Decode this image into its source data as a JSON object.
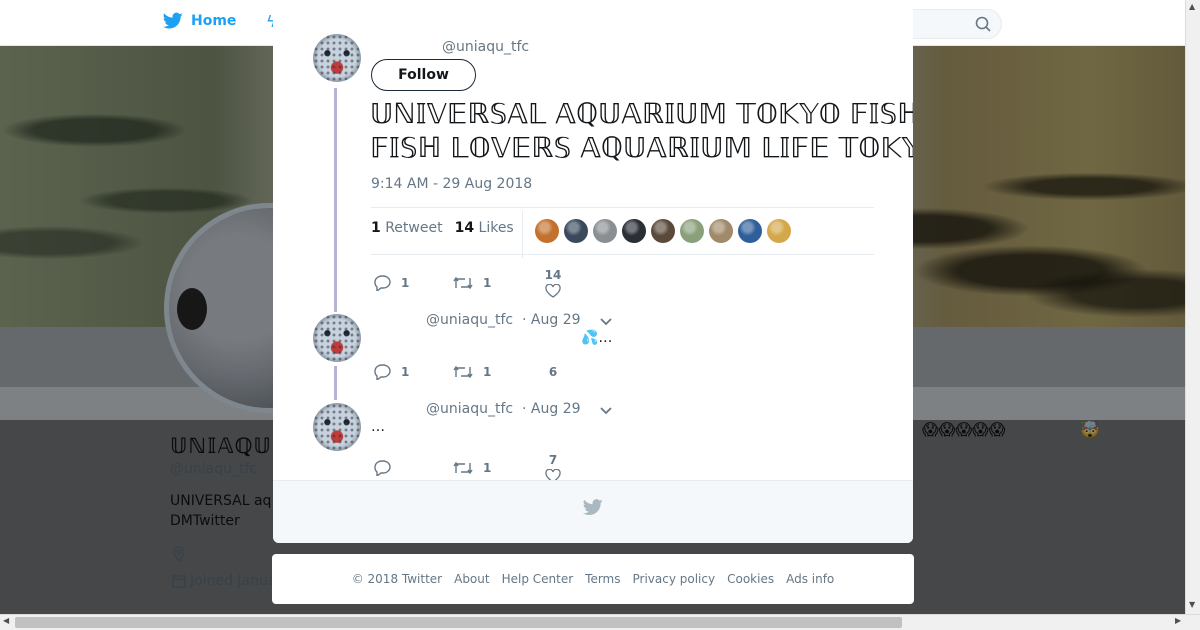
{
  "background": {
    "nav_home_label": "Home",
    "profile_name": "𝕌ℕ𝕀𝔸ℚ𝕌",
    "profile_handle": "@uniaqu_tfc",
    "bio_line1": "UNIVERSAL aq",
    "bio_line2": "DMTwitter",
    "joined": "Joined Janua",
    "emoji_right1": "😱😱😱😱😱",
    "emoji_right2": "🤯"
  },
  "tweet": {
    "handle": "@uniaqu_tfc",
    "follow_label": "Follow",
    "text_line1": "𝕌ℕ𝕀𝕍𝔼ℝ𝕊𝔸𝕃 𝔸ℚ𝕌𝔸ℝ𝕀𝕌𝕄 𝕋𝕆𝕂𝕐𝕆 𝔽𝕀𝕊ℍ ℂ𝕃𝕌𝔹 𝔸ℚ𝕌𝔸ℝ𝕀𝕌𝕄 𝕃𝕀𝔽𝔼 𝔼𝕍𝔼ℝ𝕐𝔻𝔸𝕐 𝕊𝕋𝕆ℝ𝕀𝔼𝕊",
    "text_line2": "𝔽𝕀𝕊ℍ 𝕃𝕆𝕍𝔼ℝ𝕊 𝔸ℚ𝕌𝔸ℝ𝕀𝕌𝕄 𝕃𝕀𝔽𝔼 𝕋𝕆𝕂𝕐𝕆 𝔽𝕀𝕊ℍ ℂ𝕃𝕌𝔹 𝕌ℕ𝕀𝕍𝔼ℝ𝕊𝔸𝕃 𝕋𝕆𝕂𝕐𝕆 𝔽𝕀𝕊ℍ",
    "timestamp": "9:14 AM - 29 Aug 2018",
    "retweet_count": "1",
    "retweet_label": "Retweet",
    "likes_count": "14",
    "likes_label": "Likes",
    "liker_colors": [
      "#c4712e",
      "#3a4a5c",
      "#8a8f94",
      "#2a2e35",
      "#5a4a3a",
      "#8aa07a",
      "#a08a6a",
      "#2f5f9a",
      "#d4a84a"
    ],
    "actions": {
      "reply": "1",
      "retweet": "1",
      "like": "14"
    }
  },
  "replies": [
    {
      "handle": "@uniaqu_tfc",
      "date": "· Aug 29",
      "text": "💦…",
      "actions": {
        "reply": "1",
        "retweet": "1",
        "like": "6"
      }
    },
    {
      "handle": "@uniaqu_tfc",
      "date": "· Aug 29",
      "text": "…",
      "actions": {
        "reply": "",
        "retweet": "1",
        "like": "7"
      }
    }
  ],
  "footer": {
    "copyright": "© 2018 Twitter",
    "about": "About",
    "help": "Help Center",
    "terms": "Terms",
    "privacy": "Privacy policy",
    "cookies": "Cookies",
    "ads": "Ads info"
  },
  "colors": {
    "twitter_blue": "#1da1f2",
    "thread_line": "#b8b2d6",
    "muted": "#657786"
  }
}
